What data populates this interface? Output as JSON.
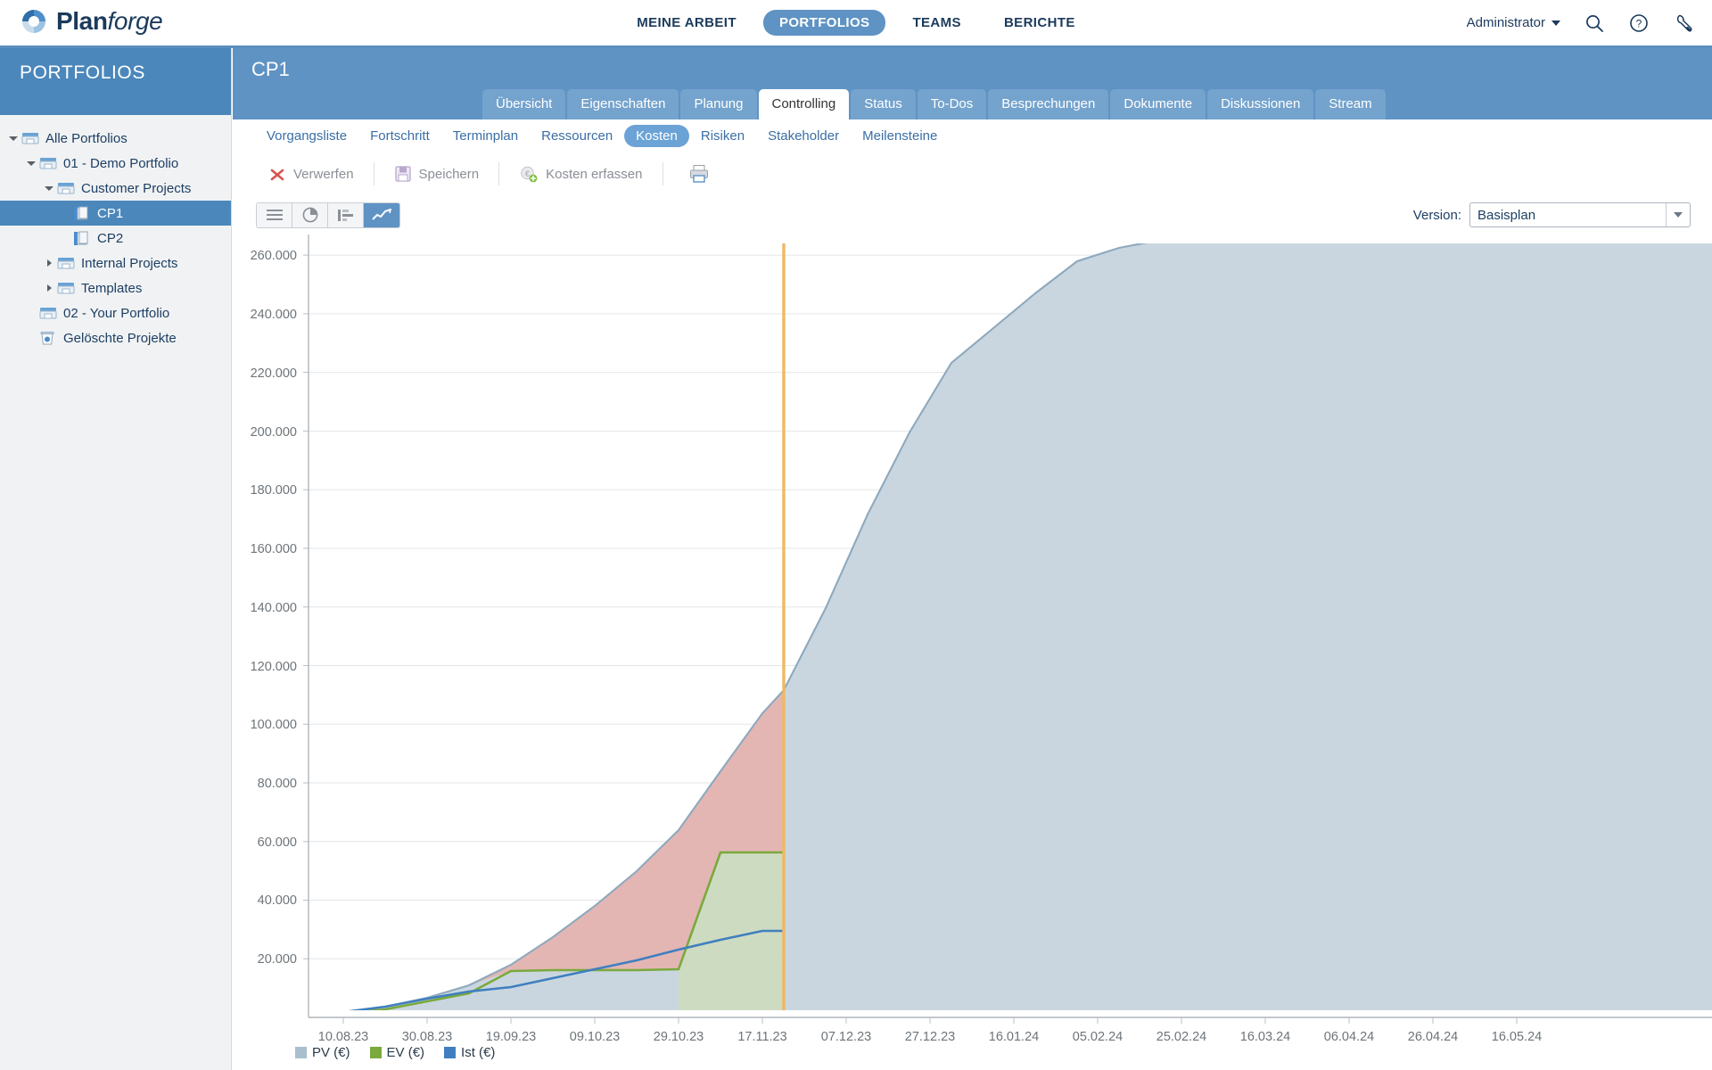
{
  "app": {
    "brand_bold": "Plan",
    "brand_italic": "forge",
    "logo_icon": "planforge-logo-icon",
    "accent": "#5f93c4",
    "header_blue": "#4b87bb"
  },
  "topnav": {
    "items": [
      {
        "label": "MEINE ARBEIT",
        "active": false
      },
      {
        "label": "PORTFOLIOS",
        "active": true
      },
      {
        "label": "TEAMS",
        "active": false
      },
      {
        "label": "BERICHTE",
        "active": false
      }
    ],
    "user": "Administrator",
    "icons": [
      "search-icon",
      "help-icon",
      "tools-icon"
    ]
  },
  "sidebar": {
    "title": "PORTFOLIOS",
    "items": [
      {
        "label": "Alle Portfolios",
        "indent": 0,
        "twisty": "open",
        "icon": "portfolio-folder-icon",
        "selected": false
      },
      {
        "label": "01 - Demo Portfolio",
        "indent": 1,
        "twisty": "open",
        "icon": "portfolio-folder-icon",
        "selected": false
      },
      {
        "label": "Customer Projects",
        "indent": 2,
        "twisty": "open",
        "icon": "portfolio-folder-icon",
        "selected": false
      },
      {
        "label": "CP1",
        "indent": 3,
        "twisty": "none",
        "icon": "project-icon",
        "selected": true
      },
      {
        "label": "CP2",
        "indent": 3,
        "twisty": "none",
        "icon": "project-icon",
        "selected": false
      },
      {
        "label": "Internal Projects",
        "indent": 2,
        "twisty": "closed",
        "icon": "portfolio-folder-icon",
        "selected": false
      },
      {
        "label": "Templates",
        "indent": 2,
        "twisty": "closed",
        "icon": "portfolio-folder-icon",
        "selected": false
      },
      {
        "label": "02 - Your Portfolio",
        "indent": 1,
        "twisty": "none",
        "icon": "portfolio-folder-icon",
        "selected": false
      },
      {
        "label": "Gelöschte Projekte",
        "indent": 1,
        "twisty": "none",
        "icon": "trash-icon",
        "selected": false
      }
    ]
  },
  "project": {
    "title": "CP1",
    "tabs": [
      {
        "label": "Übersicht",
        "active": false
      },
      {
        "label": "Eigenschaften",
        "active": false
      },
      {
        "label": "Planung",
        "active": false
      },
      {
        "label": "Controlling",
        "active": true
      },
      {
        "label": "Status",
        "active": false
      },
      {
        "label": "To-Dos",
        "active": false
      },
      {
        "label": "Besprechungen",
        "active": false
      },
      {
        "label": "Dokumente",
        "active": false
      },
      {
        "label": "Diskussionen",
        "active": false
      },
      {
        "label": "Stream",
        "active": false
      }
    ],
    "subnav": [
      {
        "label": "Vorgangsliste",
        "active": false
      },
      {
        "label": "Fortschritt",
        "active": false
      },
      {
        "label": "Terminplan",
        "active": false
      },
      {
        "label": "Ressourcen",
        "active": false
      },
      {
        "label": "Kosten",
        "active": true
      },
      {
        "label": "Risiken",
        "active": false
      },
      {
        "label": "Stakeholder",
        "active": false
      },
      {
        "label": "Meilensteine",
        "active": false
      }
    ]
  },
  "toolbar": {
    "discard_label": "Verwerfen",
    "save_label": "Speichern",
    "capture_label": "Kosten erfassen",
    "print_icon": "printer-icon"
  },
  "viewmodes": [
    {
      "icon": "list-view-icon",
      "active": false
    },
    {
      "icon": "pie-chart-icon",
      "active": false
    },
    {
      "icon": "bar-chart-icon",
      "active": false
    },
    {
      "icon": "line-chart-icon",
      "active": true
    }
  ],
  "version": {
    "label": "Version:",
    "value": "Basisplan",
    "dropdown_icon": "chevron-down-icon"
  },
  "chart_data": {
    "type": "area",
    "title": "",
    "xlabel": "",
    "ylabel": "",
    "grid": true,
    "legend_position": "bottom-left",
    "ylim": [
      0,
      280000
    ],
    "ytick_labels": [
      "20.000",
      "40.000",
      "60.000",
      "80.000",
      "100.000",
      "120.000",
      "140.000",
      "160.000",
      "180.000",
      "200.000",
      "220.000",
      "240.000",
      "260.000"
    ],
    "ytick_values": [
      20000,
      40000,
      60000,
      80000,
      100000,
      120000,
      140000,
      160000,
      180000,
      200000,
      220000,
      240000,
      260000
    ],
    "xtick_labels": [
      "10.08.23",
      "30.08.23",
      "19.09.23",
      "09.10.23",
      "29.10.23",
      "17.11.23",
      "07.12.23",
      "27.12.23",
      "16.01.24",
      "05.02.24",
      "25.02.24",
      "16.03.24",
      "06.04.24",
      "26.04.24",
      "16.05.24"
    ],
    "today_marker": {
      "label": "",
      "x_value": 68,
      "color": "#f0b860"
    },
    "x": [
      0,
      5,
      11,
      17,
      23,
      29,
      35,
      41,
      47,
      53,
      59,
      65,
      68,
      74,
      80,
      86,
      92,
      98,
      104,
      110,
      116,
      122,
      128,
      134,
      140,
      146,
      152,
      158,
      164,
      170,
      176,
      182,
      188,
      194,
      200
    ],
    "series": [
      {
        "name": "PV (€)",
        "color": "#8ea9bd",
        "fill": "#c4d3dd",
        "values": [
          0,
          1500,
          3500,
          6500,
          11000,
          18000,
          27500,
          38000,
          50000,
          64000,
          84000,
          104000,
          112000,
          140000,
          172000,
          200000,
          224000,
          236000,
          248000,
          259000,
          263500,
          266500,
          268500,
          269500,
          270000,
          270200,
          270400,
          270600,
          270800,
          271000,
          271400,
          271800,
          272200,
          272600,
          273000
        ]
      },
      {
        "name": "EV (€)",
        "color": "#7aa93c",
        "fill": "#cfe0a8",
        "values": [
          0,
          1200,
          2800,
          5600,
          8500,
          16000,
          16200,
          16300,
          16400,
          16500,
          40000,
          54500,
          55000,
          null,
          null,
          null,
          null,
          null,
          null,
          null,
          null,
          null,
          null,
          null,
          null,
          null,
          null,
          null,
          null,
          null,
          null,
          null,
          null,
          null,
          null
        ]
      },
      {
        "name": "Ist (€)",
        "color": "#3f7fbf",
        "fill": "none",
        "values": [
          0,
          1800,
          3600,
          6200,
          8800,
          10500,
          13500,
          16500,
          19500,
          23000,
          26500,
          29500,
          29600,
          null,
          null,
          null,
          null,
          null,
          null,
          null,
          null,
          null,
          null,
          null,
          null,
          null,
          null,
          null,
          null,
          null,
          null,
          null,
          null,
          null,
          null
        ]
      }
    ],
    "variance_fill": {
      "between": [
        "EV (€)",
        "PV (€)"
      ],
      "color": "#e8b0ab",
      "note": "red area where PV exceeds EV up to today marker"
    }
  },
  "legend": [
    {
      "label": "PV (€)",
      "color": "#a9bfcd"
    },
    {
      "label": "EV (€)",
      "color": "#7aa93c"
    },
    {
      "label": "Ist (€)",
      "color": "#3f7fbf"
    }
  ]
}
